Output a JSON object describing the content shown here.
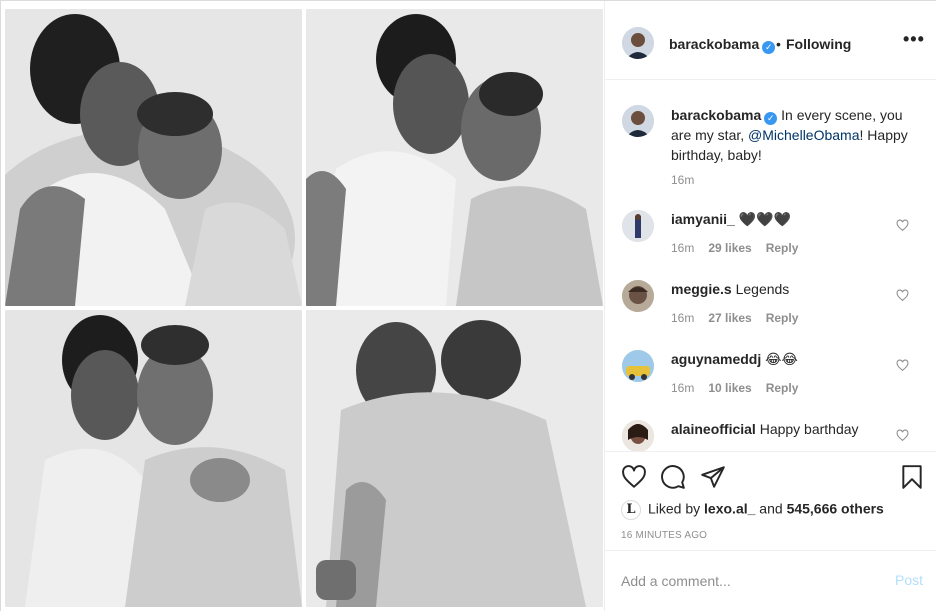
{
  "post": {
    "author": "barackobama",
    "follow_status": "Following",
    "separator": "•",
    "more_icon": "more-horizontal-icon",
    "more_label": "•••"
  },
  "media": {
    "photos": [
      {
        "name": "photo-1"
      },
      {
        "name": "photo-2"
      },
      {
        "name": "photo-3"
      },
      {
        "name": "photo-4"
      }
    ]
  },
  "caption": {
    "username": "barackobama",
    "text_before": " In every scene, you are my star, ",
    "mention": "@MichelleObama",
    "text_after": "! Happy birthday, baby!",
    "time": "16m"
  },
  "comments": [
    {
      "username": "iamyanii_",
      "text": "🖤🖤🖤",
      "time": "16m",
      "likes": "29 likes",
      "reply": "Reply"
    },
    {
      "username": "meggie.s",
      "text": "Legends",
      "time": "16m",
      "likes": "27 likes",
      "reply": "Reply"
    },
    {
      "username": "aguynameddj",
      "text": "😂😂",
      "time": "16m",
      "likes": "10 likes",
      "reply": "Reply"
    },
    {
      "username": "alaineofficial",
      "text": "Happy barthday",
      "time": "",
      "likes": "",
      "reply": ""
    }
  ],
  "actions": {
    "liked_by_prefix": "Liked by ",
    "liked_by_user": "lexo.al_",
    "liked_by_middle": " and ",
    "liked_by_count": "545,666 others",
    "liker_avatar_letter": "L",
    "time_ago": "16 MINUTES AGO"
  },
  "add_comment": {
    "placeholder": "Add a comment...",
    "post_label": "Post"
  },
  "colors": {
    "verified": "#3897f0",
    "mention": "#003569",
    "muted": "#8e8e8e",
    "post_disabled": "#b2dffc"
  }
}
